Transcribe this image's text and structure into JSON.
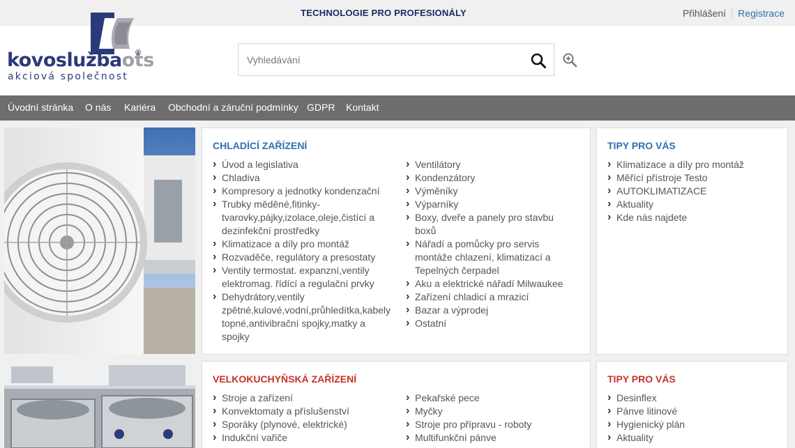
{
  "topbar": {
    "tagline": "TECHNOLOGIE PRO PROFESIONÁLY",
    "login": "Přihlášení",
    "register": "Registrace"
  },
  "logo": {
    "word": "kovoslužba",
    "suffix": "ots",
    "registered": "®",
    "subtitle": "akciová společnost"
  },
  "search": {
    "placeholder": "Vyhledávání"
  },
  "nav": {
    "items": [
      "Úvodní stránka",
      "O nás",
      "Kariéra",
      "Obchodní a záruční podmínky",
      "GDPR",
      "Kontakt"
    ]
  },
  "sections": [
    {
      "title": "CHLADÍCÍ ZAŘÍZENÍ",
      "accent": "#2f6fb0",
      "col1": [
        "Úvod a legislativa",
        "Chladiva",
        "Kompresory a jednotky kondenzační",
        "Trubky měděné,fitinky-tvarovky,pájky,izolace,oleje,čistící a dezinfekční prostředky",
        "Klimatizace a díly pro montáž",
        "Rozvaděče, regulátory a presostaty",
        "Ventily termostat. expanzní,ventily elektromag. řídící a regulační prvky",
        "Dehydrátory,ventily zpětné,kulové,vodní,průhledítka,kabely topné,antivibrační spojky,matky a spojky"
      ],
      "col2": [
        "Ventilátory",
        "Kondenzátory",
        "Výměníky",
        "Výparníky",
        "Boxy, dveře a panely pro stavbu boxů",
        "Nářadí a pomůcky pro servis montáže chlazení, klimatizací a Tepelných čerpadel",
        "Aku a elektrické nářadí Milwaukee",
        "Zařízení chladicí a mrazicí",
        "Bazar a výprodej",
        "Ostatní"
      ],
      "tips_title": "TIPY PRO VÁS",
      "tips": [
        "Klimatizace a díly pro montáž",
        "Měřící přístroje Testo",
        "AUTOKLIMATIZACE",
        "Aktuality",
        "Kde nás najdete"
      ]
    },
    {
      "title": "VELKOKUCHYŇSKÁ ZAŘÍZENÍ",
      "accent": "#c8312b",
      "col1": [
        "Stroje a zařízení",
        "Konvektomaty a příslušenství",
        "Sporáky (plynové, elektrické)",
        "Indukční vařiče"
      ],
      "col2": [
        "Pekařské pece",
        "Myčky",
        "Stroje pro přípravu - roboty",
        "Multifunkční pánve"
      ],
      "tips_title": "TIPY PRO VÁS",
      "tips": [
        "Desinflex",
        "Pánve litinové",
        "Hygienický plán",
        "Aktuality"
      ]
    }
  ],
  "icons": {
    "search": "search-icon",
    "zoom": "zoom-in-icon",
    "chevron": "chevron-right-icon"
  }
}
